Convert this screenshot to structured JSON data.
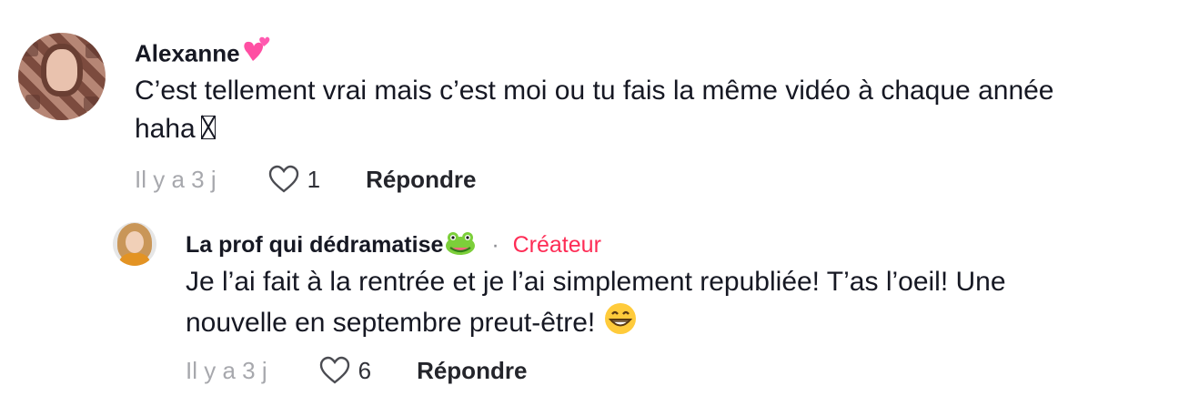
{
  "comments": [
    {
      "username": "Alexanne",
      "username_emoji_icon": "two-hearts-icon",
      "text": "C’est tellement vrai mais c’est moi ou tu fais la même vidéo à chaque année",
      "text_line2": "haha",
      "missing_glyph_icon": "missing-glyph-icon",
      "time": "Il y a 3 j",
      "likes": "1",
      "reply_label": "Répondre"
    },
    {
      "username": "La prof qui dédramatise",
      "username_emoji_icon": "frog-icon",
      "creator_separator": "·",
      "creator_badge": "Créateur",
      "text": "Je l’ai fait à la rentrée et je l’ai simplement republiée! T’as l’oeil! Une",
      "text_line2": "nouvelle en septembre preut-être!",
      "trailing_emoji_icon": "grinning-face-icon",
      "time": "Il y a 3 j",
      "likes": "6",
      "reply_label": "Répondre"
    }
  ],
  "colors": {
    "text": "#161823",
    "muted": "#8a8b91",
    "creator": "#fe2c55"
  }
}
